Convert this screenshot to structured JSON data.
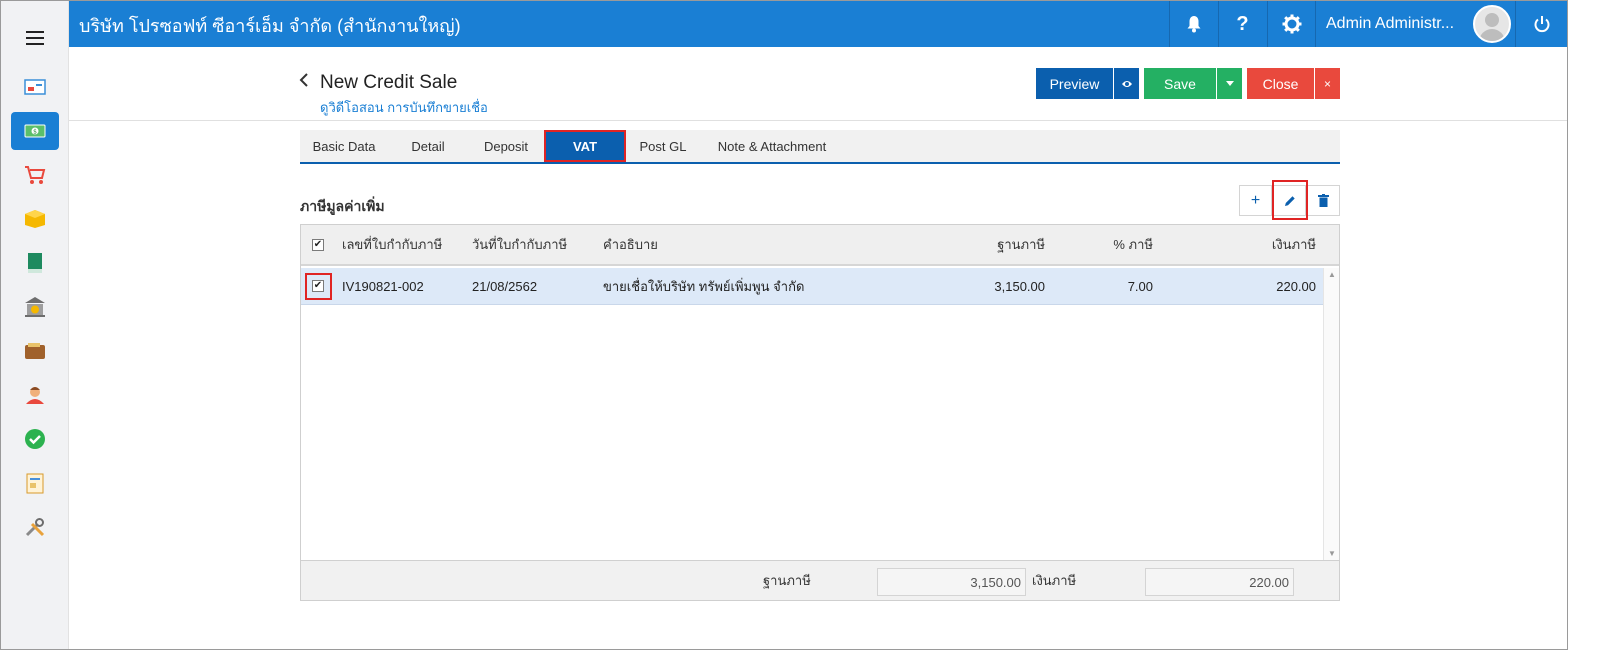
{
  "header": {
    "company": "บริษัท โปรซอฟท์ ซีอาร์เอ็ม จำกัด (สำนักงานใหญ่)",
    "user_name": "Admin Administr...",
    "icons": [
      "bell-icon",
      "help-icon",
      "gear-icon",
      "avatar",
      "power-icon"
    ],
    "help_label": "?"
  },
  "sidebar": {
    "items": [
      "dashboard-icon",
      "money-icon",
      "cart-icon",
      "box-icon",
      "book-icon",
      "bank-icon",
      "wallet-icon",
      "contact-icon",
      "check-icon",
      "document-icon",
      "tools-icon"
    ],
    "active_index": 1
  },
  "page": {
    "title": "New Credit Sale",
    "subtitle": "ดูวิดีโอสอน การบันทึกขายเชื่อ"
  },
  "toolbar": {
    "preview_label": "Preview",
    "save_label": "Save",
    "close_label": "Close",
    "close_x": "×"
  },
  "tabs": [
    "Basic Data",
    "Detail",
    "Deposit",
    "VAT",
    "Post GL",
    "Note & Attachment"
  ],
  "active_tab": "VAT",
  "section": {
    "title": "ภาษีมูลค่าเพิ่ม",
    "add_label": "+"
  },
  "table": {
    "columns": [
      "เลขที่ใบกำกับภาษี",
      "วันที่ใบกำกับภาษี",
      "คำอธิบาย",
      "ฐานภาษี",
      "% ภาษี",
      "เงินภาษี"
    ],
    "rows": [
      {
        "checked": true,
        "invoice_no": "IV190821-002",
        "invoice_date": "21/08/2562",
        "description": "ขายเชื่อให้บริษัท ทรัพย์เพิ่มพูน จำกัด",
        "tax_base": "3,150.00",
        "tax_percent": "7.00",
        "tax_amount": "220.00"
      }
    ]
  },
  "footer": {
    "tax_base_label": "ฐานภาษี",
    "tax_base_value": "3,150.00",
    "tax_amount_label": "เงินภาษี",
    "tax_amount_value": "220.00"
  },
  "colors": {
    "header_blue": "#1a7fd4",
    "dark_blue": "#0b5fae",
    "save_green": "#24b063",
    "close_red": "#e9493d",
    "highlight_red": "#e02424",
    "row_selected": "#dde9f8"
  }
}
